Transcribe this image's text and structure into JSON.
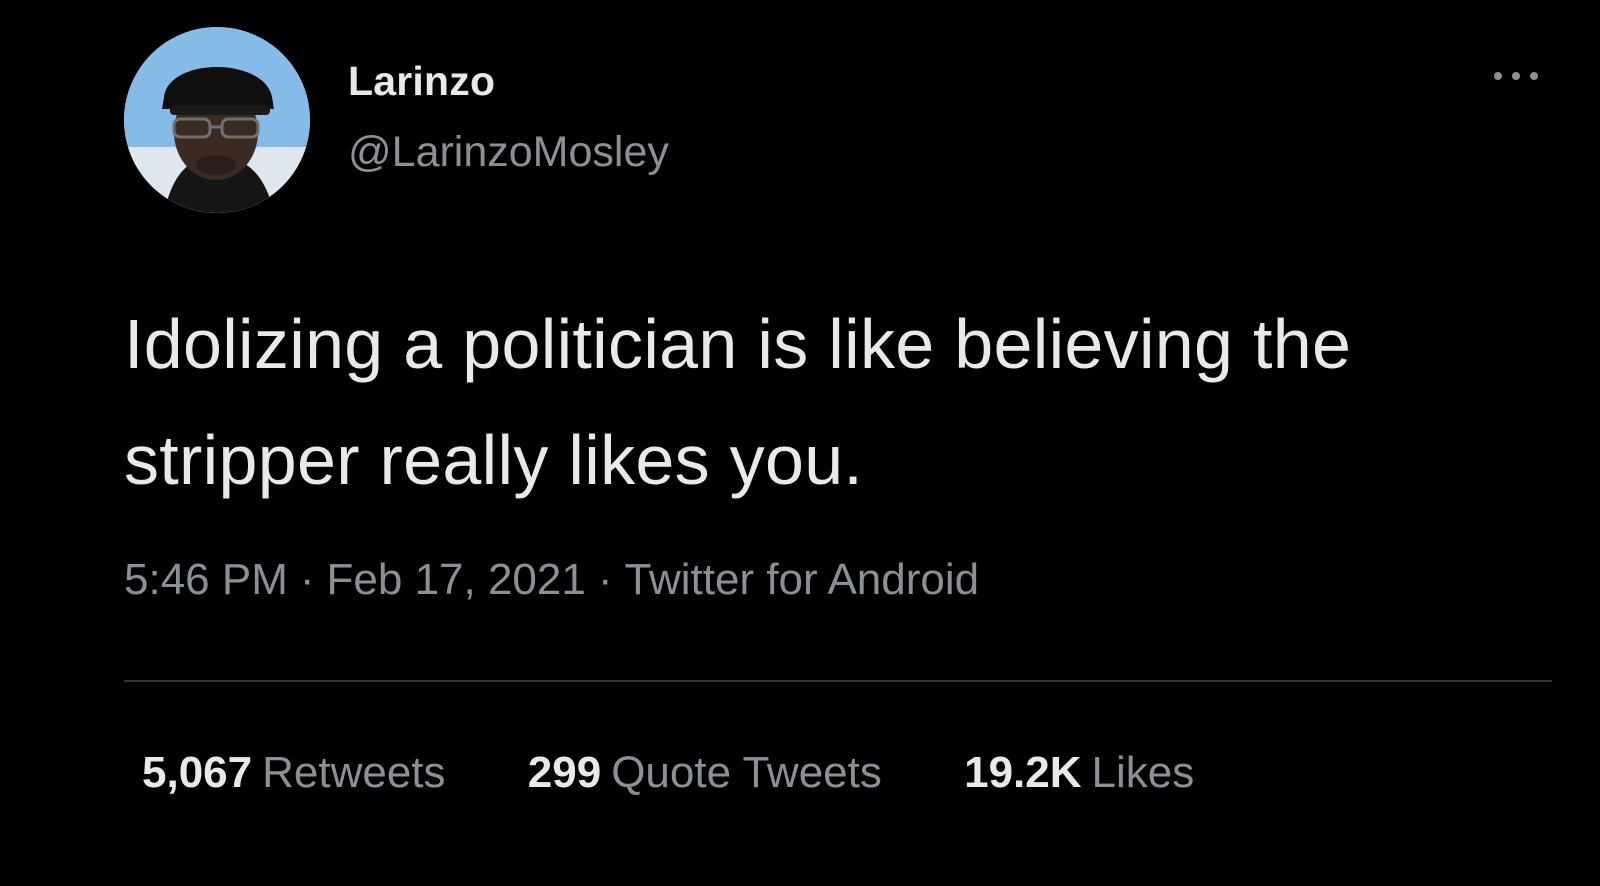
{
  "user": {
    "display_name": "Larinzo",
    "handle": "@LarinzoMosley",
    "avatar_icon": "profile-photo"
  },
  "tweet": {
    "text": "Idolizing a politician is like believing the stripper really likes you.",
    "time": "5:46 PM",
    "date": "Feb 17, 2021",
    "source": "Twitter for Android",
    "separator": "·"
  },
  "stats": {
    "retweets_count": "5,067",
    "retweets_label": "Retweets",
    "quotes_count": "299",
    "quotes_label": "Quote Tweets",
    "likes_count": "19.2K",
    "likes_label": "Likes"
  },
  "menu": {
    "more_icon": "ellipsis-icon"
  },
  "colors": {
    "background": "#000000",
    "primary_text": "#e7e9ea",
    "secondary_text": "#8b9096",
    "divider": "#2f3336"
  }
}
